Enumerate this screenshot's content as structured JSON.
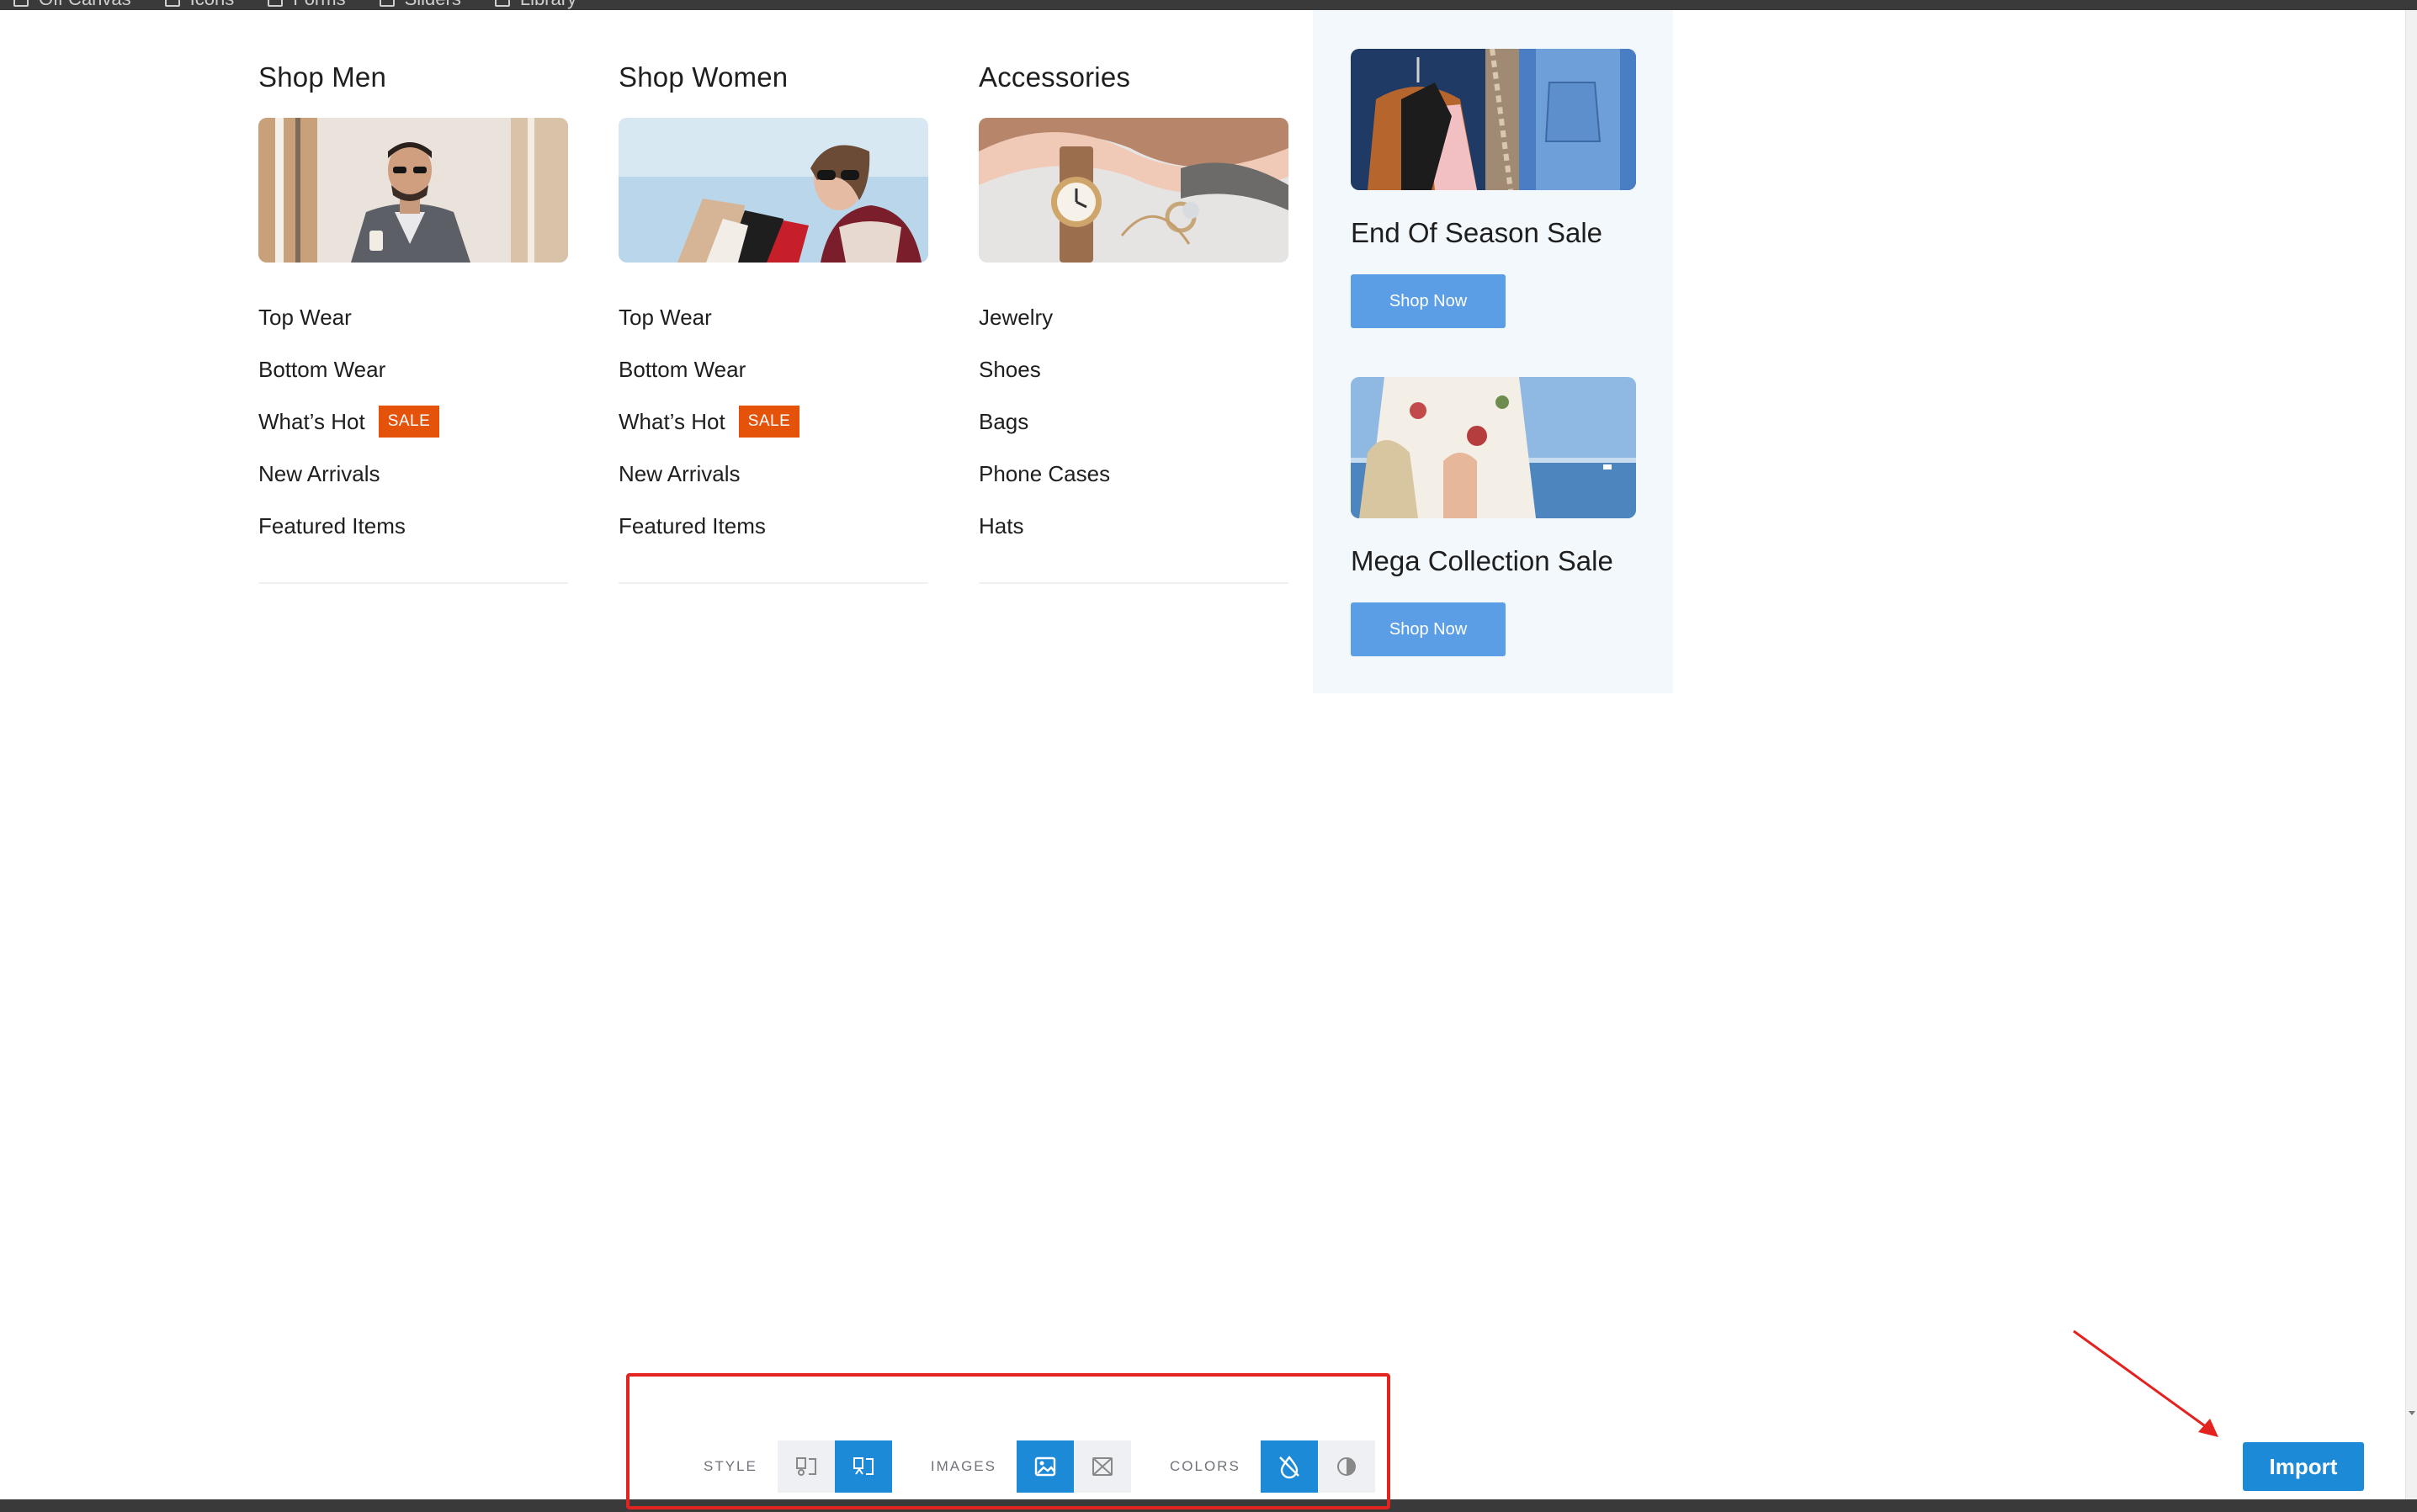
{
  "topbar": {
    "items": [
      {
        "label": "Off Canvas",
        "icon": "canvas-icon"
      },
      {
        "label": "Icons",
        "icon": "icons-icon"
      },
      {
        "label": "Forms",
        "icon": "forms-icon"
      },
      {
        "label": "Sliders",
        "icon": "sliders-icon"
      },
      {
        "label": "Library",
        "icon": "library-icon"
      }
    ]
  },
  "columns": [
    {
      "title": "Shop Men",
      "links": [
        {
          "label": "Top Wear"
        },
        {
          "label": "Bottom Wear"
        },
        {
          "label": "What’s Hot",
          "badge": "SALE"
        },
        {
          "label": "New Arrivals"
        },
        {
          "label": "Featured Items"
        }
      ]
    },
    {
      "title": "Shop Women",
      "links": [
        {
          "label": "Top Wear"
        },
        {
          "label": "Bottom Wear"
        },
        {
          "label": "What’s Hot",
          "badge": "SALE"
        },
        {
          "label": "New Arrivals"
        },
        {
          "label": "Featured Items"
        }
      ]
    },
    {
      "title": "Accessories",
      "links": [
        {
          "label": "Jewelry"
        },
        {
          "label": "Shoes"
        },
        {
          "label": "Bags"
        },
        {
          "label": "Phone Cases"
        },
        {
          "label": "Hats"
        }
      ]
    }
  ],
  "promos": [
    {
      "title": "End Of Season Sale",
      "button": "Shop Now"
    },
    {
      "title": "Mega Collection Sale",
      "button": "Shop Now"
    }
  ],
  "toolbar": {
    "style_label": "STYLE",
    "images_label": "IMAGES",
    "colors_label": "COLORS"
  },
  "import_button": "Import",
  "colors": {
    "accent": "#1d8ad8",
    "shop_button": "#5b9ee6",
    "sale_badge": "#e5530b",
    "highlight": "#e3231f",
    "promo_panel": "#f3f8fd"
  }
}
